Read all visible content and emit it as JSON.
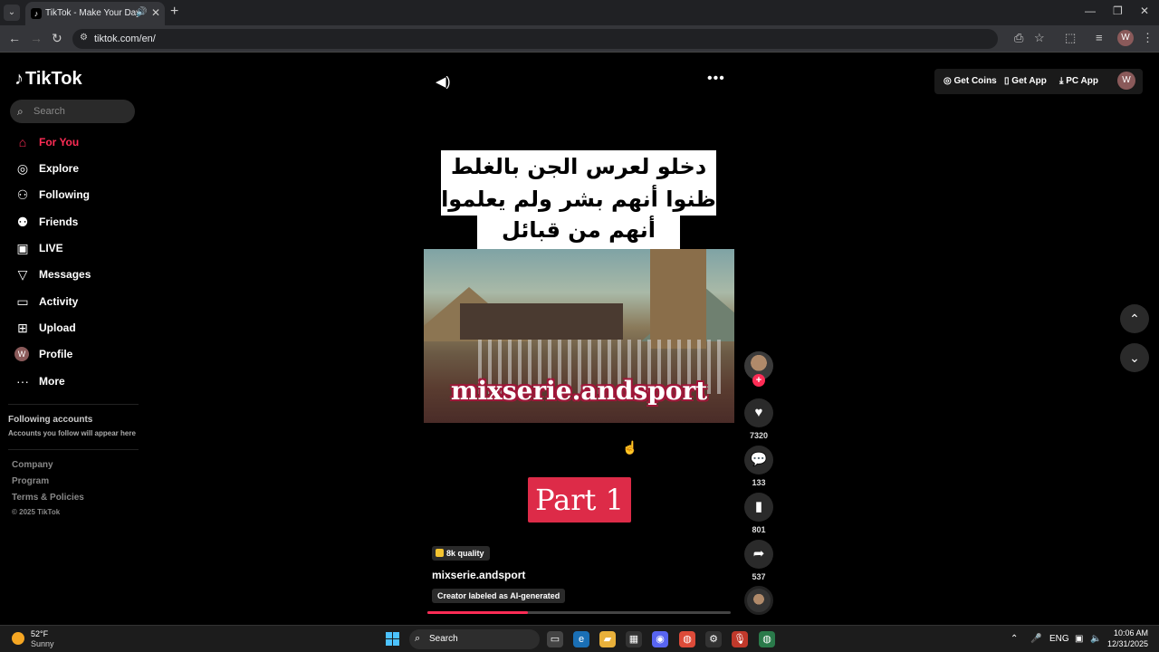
{
  "browser": {
    "tab_title": "TikTok - Make Your Day",
    "url": "tiktok.com/en/"
  },
  "sidebar": {
    "logo": "TikTok",
    "search_placeholder": "Search",
    "items": [
      {
        "label": "For You",
        "icon": "home-icon",
        "active": true
      },
      {
        "label": "Explore",
        "icon": "compass-icon"
      },
      {
        "label": "Following",
        "icon": "person-icon"
      },
      {
        "label": "Friends",
        "icon": "people-icon"
      },
      {
        "label": "LIVE",
        "icon": "live-icon"
      },
      {
        "label": "Messages",
        "icon": "send-icon"
      },
      {
        "label": "Activity",
        "icon": "activity-icon"
      },
      {
        "label": "Upload",
        "icon": "upload-icon"
      },
      {
        "label": "Profile",
        "icon": "avatar-icon"
      },
      {
        "label": "More",
        "icon": "more-icon"
      }
    ],
    "following_title": "Following accounts",
    "following_sub": "Accounts you follow will appear here",
    "footer": [
      "Company",
      "Program",
      "Terms & Policies"
    ],
    "copyright": "© 2025 TikTok"
  },
  "top_right": {
    "get_coins": "Get Coins",
    "get_app": "Get App",
    "pc_app": "PC App",
    "avatar_letter": "W"
  },
  "video": {
    "caption_lines": [
      "دخلو لعرس الجن بالغلط",
      "ظنوا أنهم بشر ولم يعلموا",
      "أنهم من قبائل الجن"
    ],
    "watermark": "mixserie.andsport",
    "part": "Part 1",
    "quality": "8k quality",
    "author": "mixserie.andsport",
    "ai_label": "Creator labeled as AI-generated",
    "progress": 0.33
  },
  "actions": {
    "likes": "7320",
    "comments": "133",
    "saves": "801",
    "shares": "537"
  },
  "taskbar": {
    "temp": "52°F",
    "weather": "Sunny",
    "search": "Search",
    "lang": "ENG",
    "time": "10:06 AM",
    "date": "12/31/2025"
  }
}
